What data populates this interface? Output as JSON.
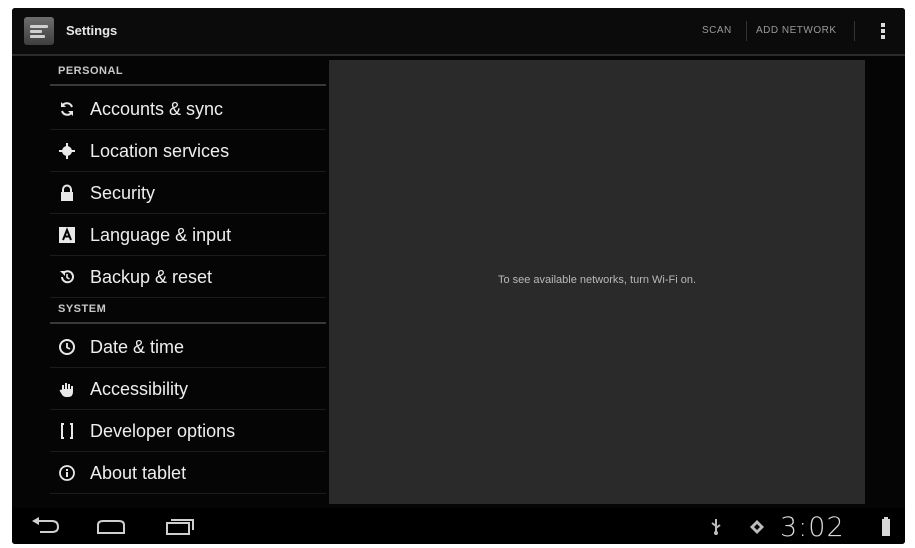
{
  "action_bar": {
    "title": "Settings",
    "actions": [
      "SCAN",
      "ADD NETWORK"
    ],
    "icons": {
      "app": "settings-app-icon",
      "overflow": "overflow-menu-icon"
    }
  },
  "sections": [
    {
      "header": "PERSONAL",
      "items": [
        {
          "label": "Accounts & sync",
          "icon": "sync-icon"
        },
        {
          "label": "Location services",
          "icon": "location-icon"
        },
        {
          "label": "Security",
          "icon": "lock-icon"
        },
        {
          "label": "Language & input",
          "icon": "keyboard-icon"
        },
        {
          "label": "Backup & reset",
          "icon": "backup-icon"
        }
      ]
    },
    {
      "header": "SYSTEM",
      "items": [
        {
          "label": "Date & time",
          "icon": "clock-icon"
        },
        {
          "label": "Accessibility",
          "icon": "hand-icon"
        },
        {
          "label": "Developer options",
          "icon": "braces-icon"
        },
        {
          "label": "About tablet",
          "icon": "info-icon"
        }
      ]
    }
  ],
  "detail": {
    "message": "To see available networks, turn Wi-Fi on."
  },
  "system_bar": {
    "time": "3:02",
    "nav_icons": [
      "back-icon",
      "home-icon",
      "recent-apps-icon"
    ],
    "status_icons": [
      "usb-icon",
      "debug-icon",
      "battery-icon"
    ]
  }
}
